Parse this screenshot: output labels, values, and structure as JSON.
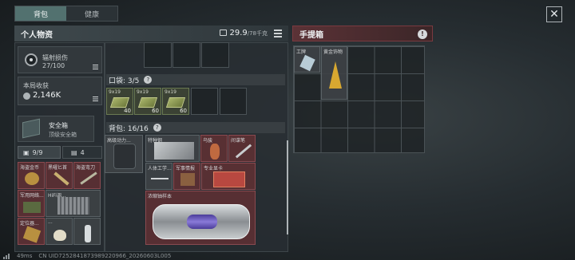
{
  "tabs": [
    {
      "label": "背包"
    },
    {
      "label": "健康"
    }
  ],
  "personal": {
    "title": "个人物资",
    "weight": "29.9",
    "weight_unit": "/78千克"
  },
  "case": {
    "title": "手提箱"
  },
  "radiation": {
    "label": "辐射损伤",
    "value": "27/100"
  },
  "earnings": {
    "label": "本局收获",
    "value": "2,146K"
  },
  "safebox": {
    "label": "安全箱",
    "sub": "顶级安全箱"
  },
  "counters": {
    "a": "9/9",
    "b": "4"
  },
  "pockets": {
    "label": "口袋: 3/5"
  },
  "backpack": {
    "label": "背包: 16/16"
  },
  "ammo": [
    {
      "label": "9x19",
      "count": "40"
    },
    {
      "label": "9x19",
      "count": "60"
    },
    {
      "label": "9x19",
      "count": "60"
    }
  ],
  "items": {
    "i1": "海盗金币",
    "i2": "黑曜匕首",
    "i3": "海盗弯刀",
    "i4": "军用网络...",
    "i5": "HiFi调...",
    "i6": "黄金饰物",
    "i7": "高级动力...",
    "i8": "特种钢",
    "i9": "乌骏",
    "i10": "间谍笔",
    "i11": "人体工学...",
    "i12": "军事情报",
    "i13": "专业显卡",
    "i14": "浓缩铀样本",
    "i15": "定位器...",
    "i16": "...",
    "case1": "工牌",
    "case2": "黄金饰物"
  },
  "footer": {
    "ping": "49ms",
    "uid": "CN UID7252841873989220966_20260603L005"
  }
}
